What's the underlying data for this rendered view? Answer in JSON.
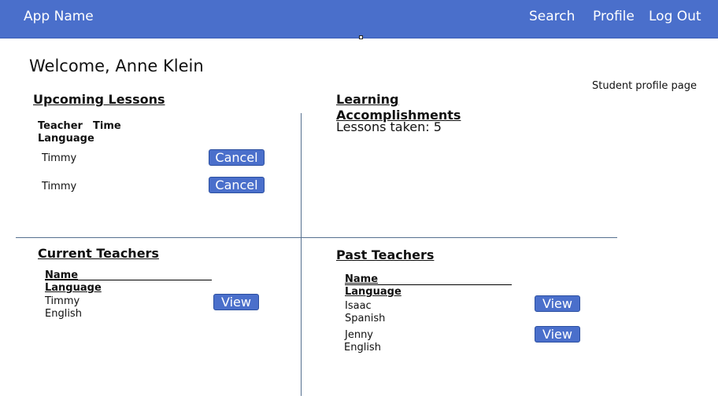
{
  "header": {
    "app_name": "App Name",
    "nav": {
      "search": "Search",
      "profile": "Profile",
      "logout": "Log Out"
    }
  },
  "welcome": "Welcome, Anne Klein",
  "page_label": "Student profile page",
  "upcoming": {
    "title": "Upcoming Lessons",
    "columns": {
      "teacher": "Teacher",
      "time": "Time",
      "language": "Language"
    },
    "rows": [
      {
        "teacher": "Timmy",
        "action": "Cancel"
      },
      {
        "teacher": "Timmy",
        "action": "Cancel"
      }
    ]
  },
  "accomplishments": {
    "title_line1": "Learning",
    "title_line2": "Accomplishments",
    "lessons_taken": "Lessons taken: 5"
  },
  "current_teachers": {
    "title": "Current Teachers",
    "columns": {
      "name": "Name",
      "language": "Language"
    },
    "rows": [
      {
        "name": "Timmy",
        "language": "English",
        "action": "View"
      }
    ]
  },
  "past_teachers": {
    "title": "Past Teachers",
    "columns": {
      "name": "Name",
      "language": "Language"
    },
    "rows": [
      {
        "name": "Isaac",
        "language": "Spanish",
        "action": "View"
      },
      {
        "name": "Jenny",
        "language": "English",
        "action": "View"
      }
    ]
  },
  "colors": {
    "accent": "#4a6fcb",
    "divider": "#56708f"
  }
}
